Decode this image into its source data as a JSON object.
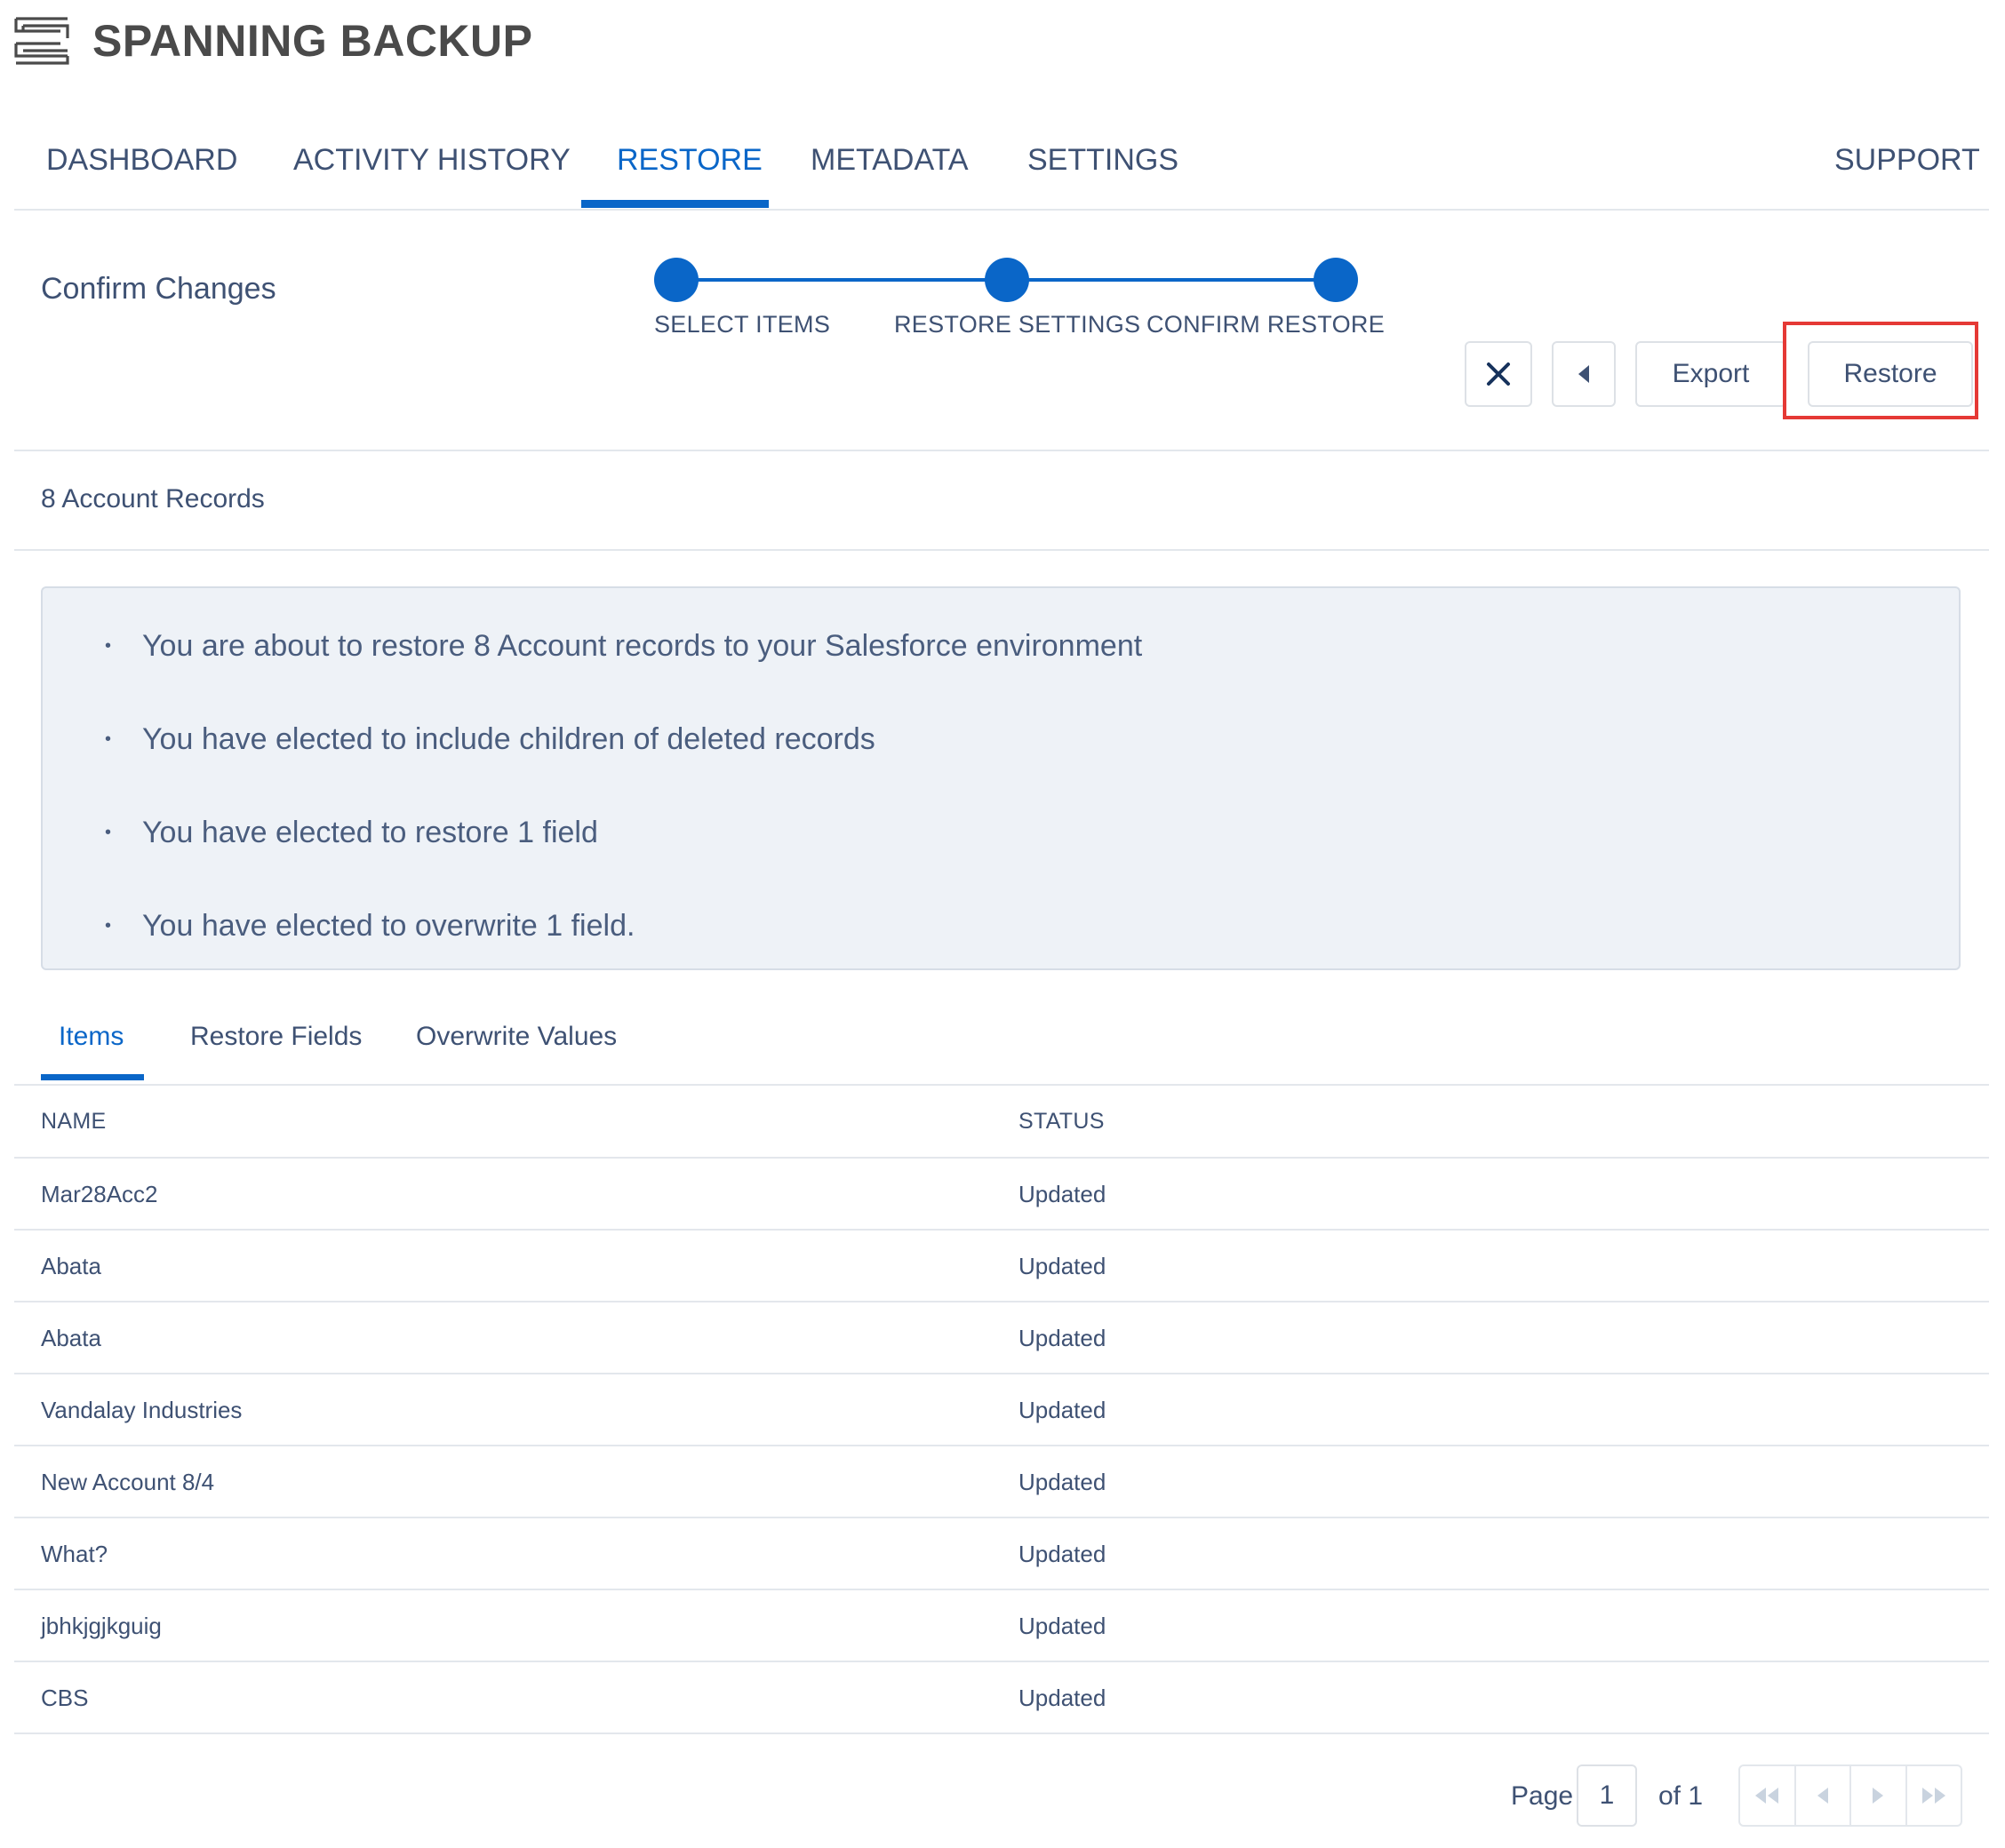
{
  "app": {
    "brand": "SPANNING BACKUP"
  },
  "nav": {
    "items": [
      "DASHBOARD",
      "ACTIVITY HISTORY",
      "RESTORE",
      "METADATA",
      "SETTINGS"
    ],
    "active": "RESTORE",
    "support": "SUPPORT"
  },
  "wizard": {
    "title": "Confirm Changes",
    "steps": [
      "SELECT ITEMS",
      "RESTORE SETTINGS",
      "CONFIRM RESTORE"
    ],
    "buttons": {
      "close_icon": "close-icon",
      "back_icon": "caret-left-icon",
      "export": "Export",
      "restore": "Restore"
    }
  },
  "section": {
    "title": "8 Account Records"
  },
  "summary": {
    "items": [
      "You are about to restore 8 Account records to your Salesforce environment",
      "You have elected to include children of deleted records",
      "You have elected to restore 1 field",
      "You have elected to overwrite 1 field."
    ]
  },
  "tabs": {
    "items": [
      "Items",
      "Restore Fields",
      "Overwrite Values"
    ],
    "active": "Items"
  },
  "table": {
    "headers": {
      "name": "NAME",
      "status": "STATUS"
    },
    "rows": [
      {
        "name": "Mar28Acc2",
        "status": "Updated"
      },
      {
        "name": "Abata",
        "status": "Updated"
      },
      {
        "name": "Abata",
        "status": "Updated"
      },
      {
        "name": "Vandalay Industries",
        "status": "Updated"
      },
      {
        "name": "New Account 8/4",
        "status": "Updated"
      },
      {
        "name": "What?",
        "status": "Updated"
      },
      {
        "name": "jbhkjgjkguig",
        "status": "Updated"
      },
      {
        "name": "CBS",
        "status": "Updated"
      }
    ]
  },
  "pager": {
    "label": "Page",
    "current": "1",
    "of": "of 1",
    "icons": [
      "first-page-icon",
      "prev-page-icon",
      "next-page-icon",
      "last-page-icon"
    ]
  },
  "colors": {
    "accent": "#0a66c8",
    "text": "#3e5173",
    "highlight": "#e53935",
    "panel": "#eef2f7"
  }
}
